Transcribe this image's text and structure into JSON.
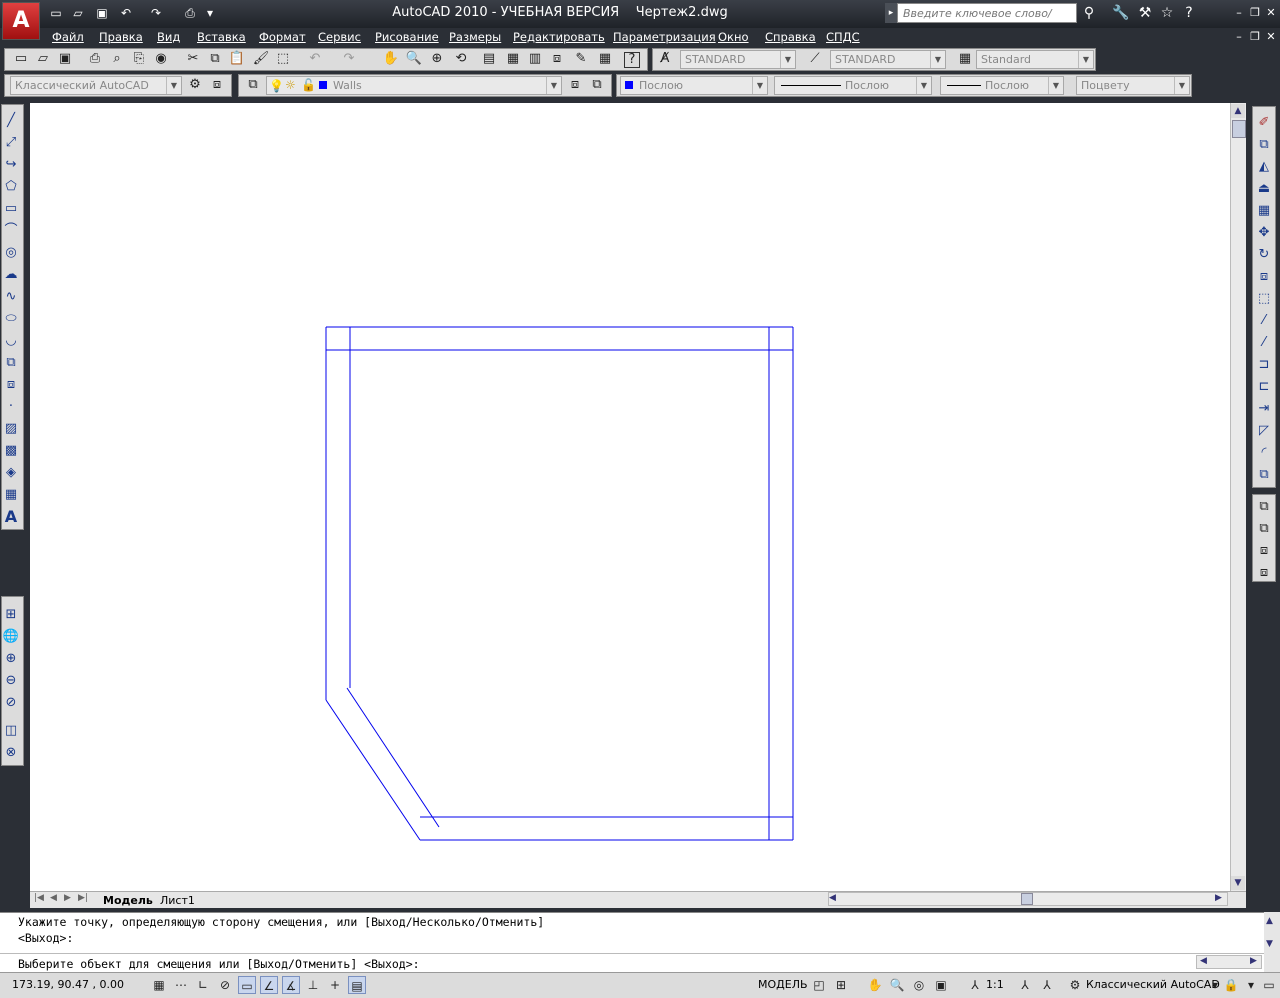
{
  "window": {
    "title": "AutoCAD 2010 - УЧЕБНАЯ ВЕРСИЯ    Чертеж2.dwg",
    "search_placeholder": "Введите ключевое слово/фразу"
  },
  "menu": [
    "Файл",
    "Правка",
    "Вид",
    "Вставка",
    "Формат",
    "Сервис",
    "Рисование",
    "Размеры",
    "Редактировать",
    "Параметризация",
    "Окно",
    "Справка",
    "СПДС"
  ],
  "toolbar": {
    "text_style": "STANDARD",
    "dim_style": "STANDARD",
    "table_style": "Standard",
    "workspace": "Классический AutoCAD",
    "layer": "Walls",
    "color": "Послою",
    "linetype": "Послою",
    "lineweight": "Послою",
    "plotstyle": "Поцвету"
  },
  "tabs": {
    "model": "Модель",
    "layout": "Лист1"
  },
  "command": {
    "line1": "Укажите точку, определяющую сторону смещения, или [Выход/Несколько/Отменить]",
    "line2": "<Выход>:",
    "prompt": "Выберите объект для смещения или [Выход/Отменить] <Выход>:"
  },
  "status": {
    "coords": "173.19, 90.47 , 0.00",
    "model_label": "МОДЕЛЬ",
    "scale": "1:1",
    "workspace": "Классический AutoCAD"
  },
  "colors": {
    "drawing_lines": "#0000ee",
    "layer_color": "#0000ff"
  }
}
